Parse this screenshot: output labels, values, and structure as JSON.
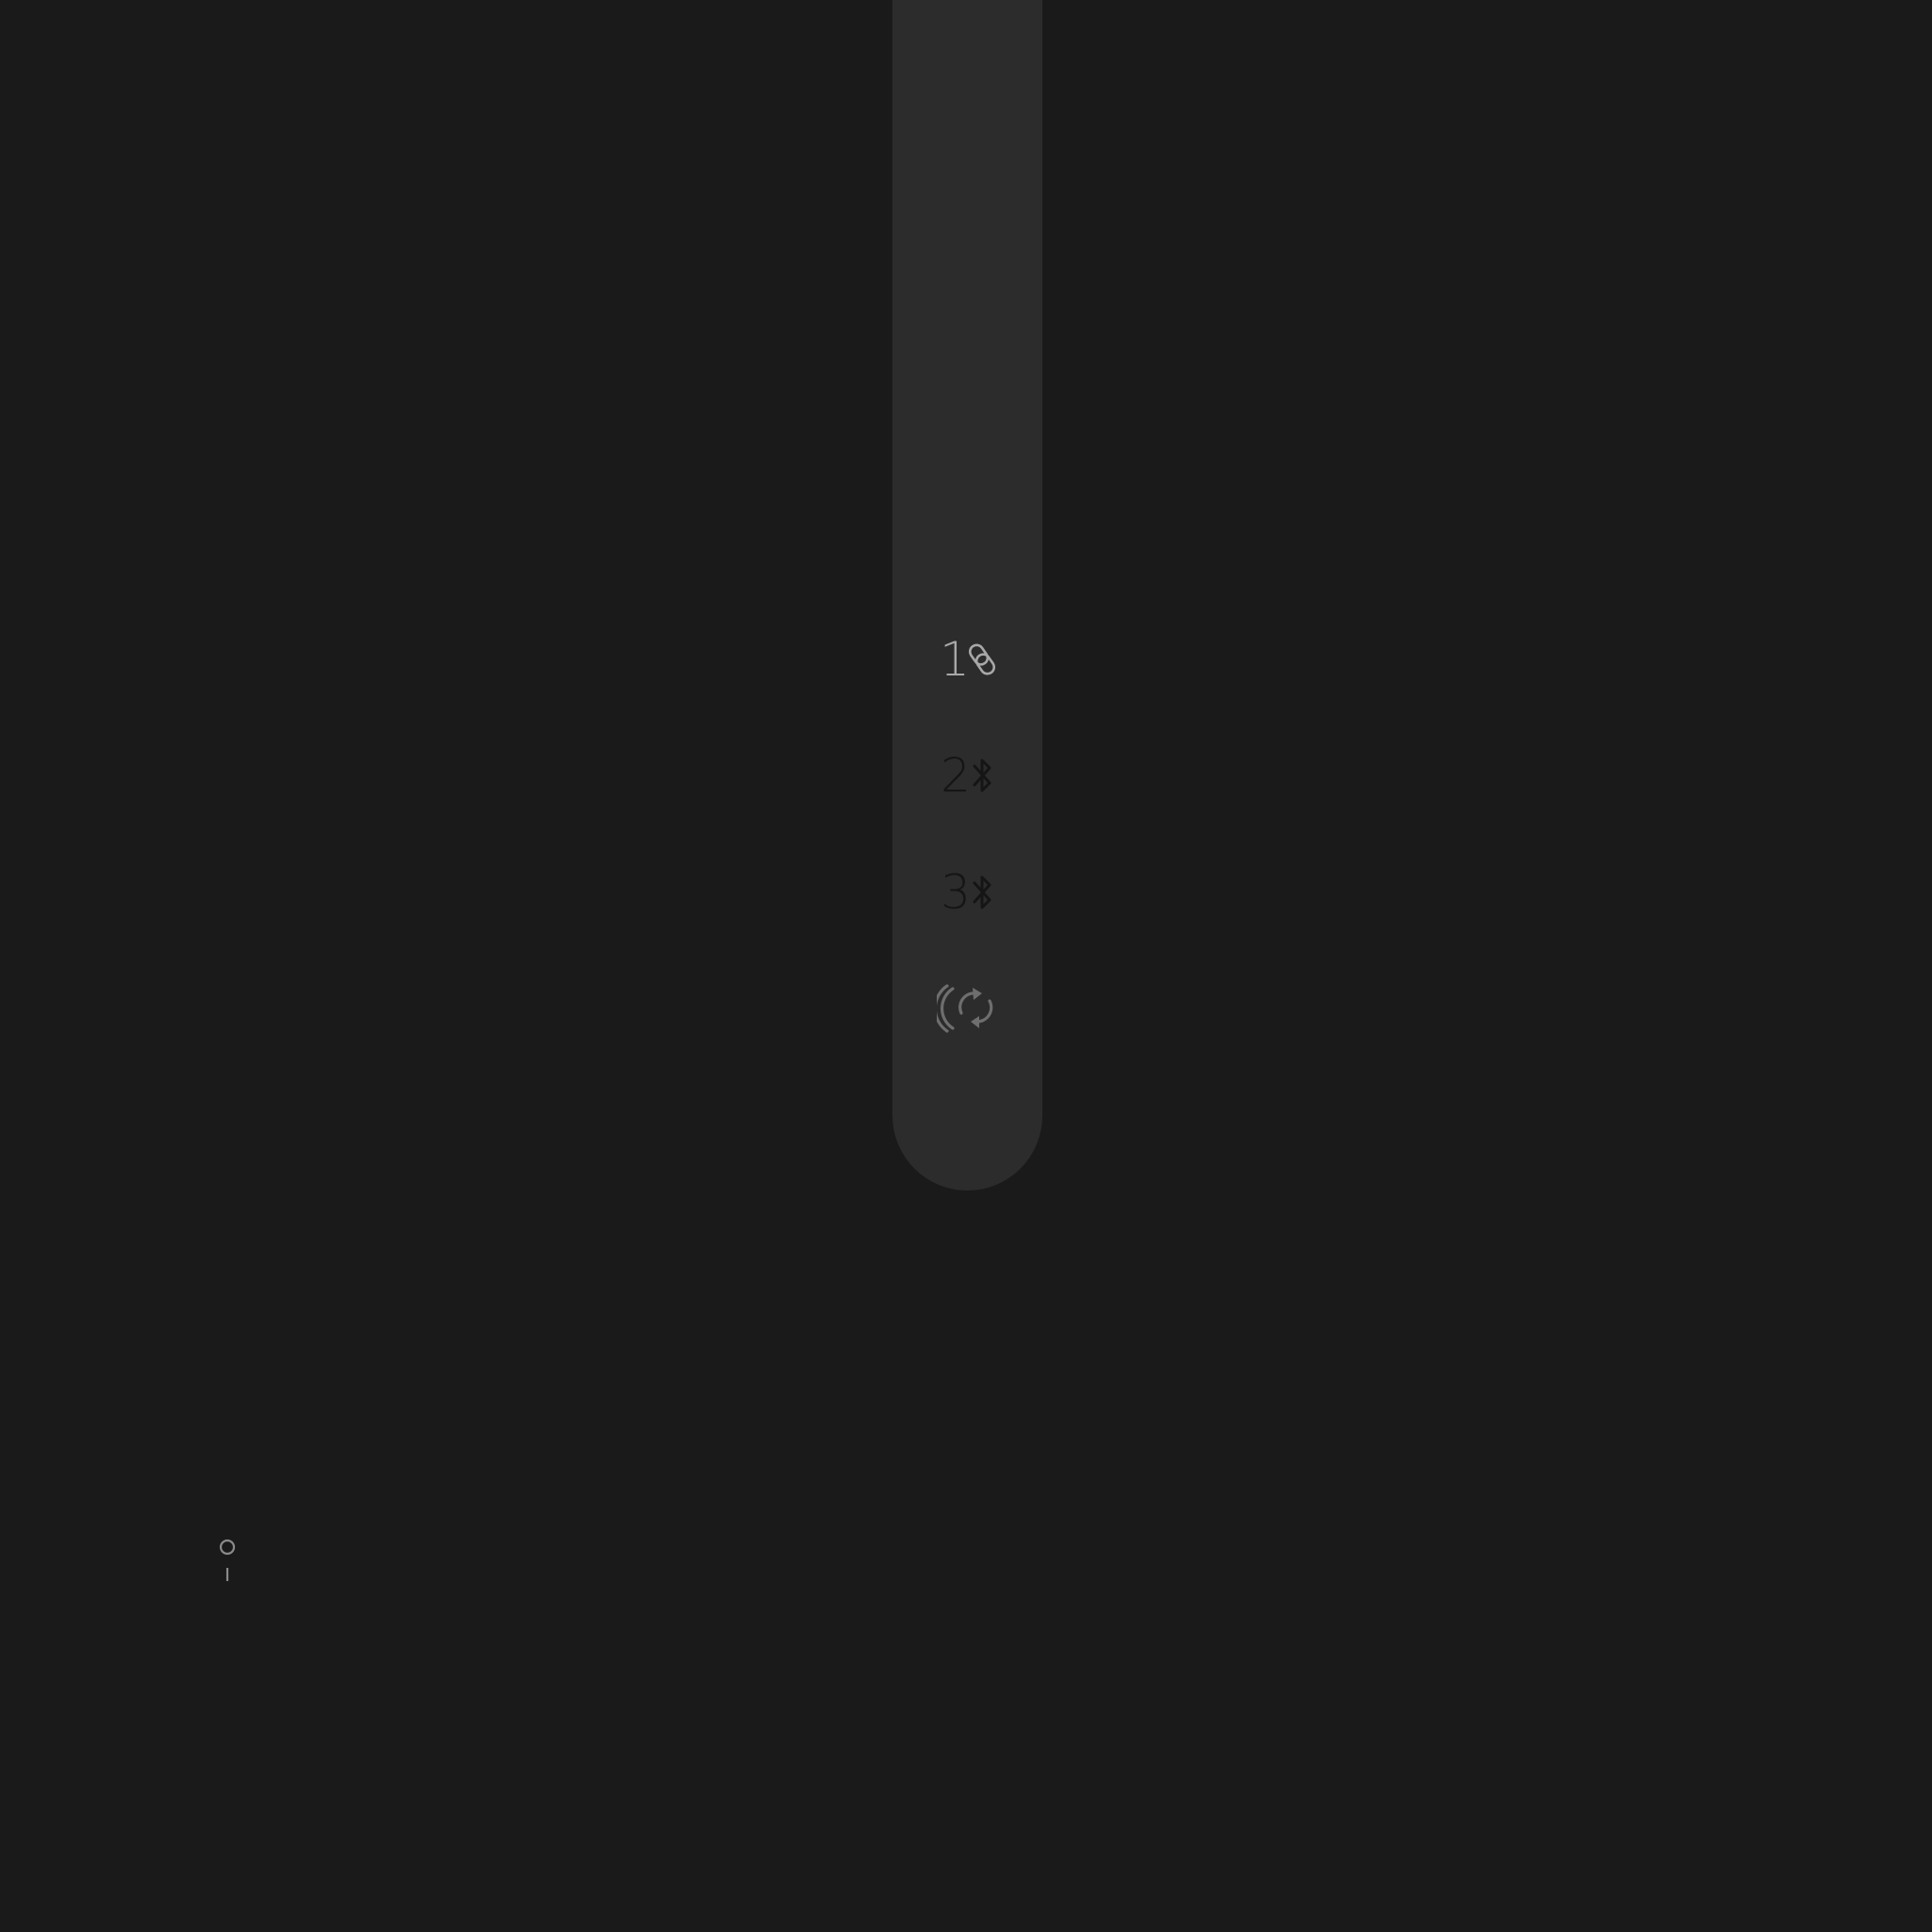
{
  "channels": [
    {
      "number": "1",
      "icon": "link-icon",
      "state": "active"
    },
    {
      "number": "2",
      "icon": "bluetooth-icon",
      "state": "inactive"
    },
    {
      "number": "3",
      "icon": "bluetooth-icon",
      "state": "inactive"
    }
  ],
  "pairing": {
    "icon": "pairing-refresh-icon"
  },
  "power_switch": {
    "icon": "power-switch-icon"
  },
  "colors": {
    "background": "#1a1a1a",
    "strip": "#2c2c2c",
    "active": "#a8a8a8",
    "inactive": "#151515",
    "pairing": "#6e6e6e"
  }
}
